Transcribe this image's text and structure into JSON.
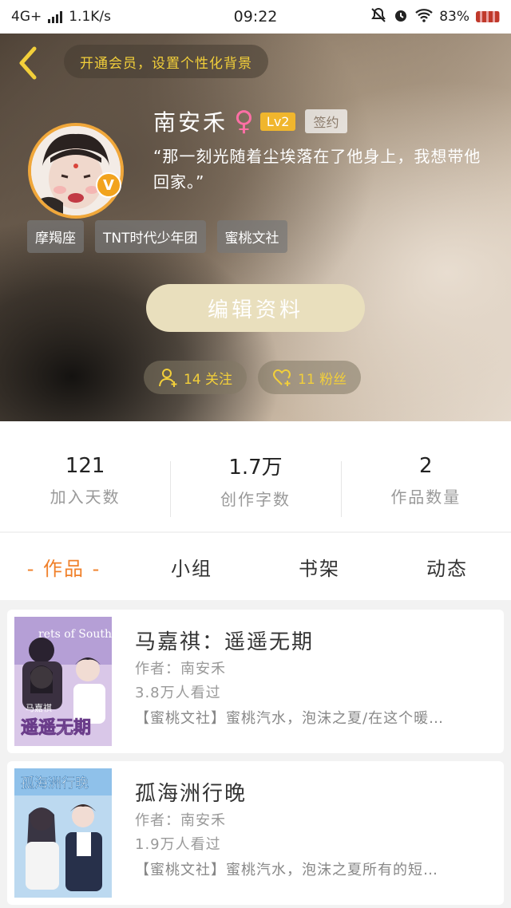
{
  "status_bar": {
    "network": "4G+",
    "speed": "1.1K/s",
    "time": "09:22",
    "battery": "83%",
    "icons": [
      "signal-icon",
      "mute-icon",
      "alarm-icon",
      "wifi-icon",
      "battery-icon"
    ]
  },
  "header": {
    "vip_prompt": "开通会员，设置个性化背景",
    "username": "南安禾",
    "gender_symbol": "♀",
    "level": "Lv2",
    "signed_badge": "签约",
    "bio": "“那一刻光随着尘埃落在了他身上，我想带他回家。”",
    "verified_mark": "V",
    "tags": [
      "摩羯座",
      "TNT时代少年团",
      "蜜桃文社"
    ],
    "edit_button": "编辑资料",
    "follow_label": "14 关注",
    "fans_label": "11 粉丝"
  },
  "stats": [
    {
      "value": "121",
      "label": "加入天数"
    },
    {
      "value": "1.7万",
      "label": "创作字数"
    },
    {
      "value": "2",
      "label": "作品数量"
    }
  ],
  "tabs": [
    "- 作品 -",
    "小组",
    "书架",
    "动态"
  ],
  "active_tab": 0,
  "works": [
    {
      "title": "马嘉祺：遥遥无期",
      "author": "作者：南安禾",
      "views": "3.8万人看过",
      "description": "【蜜桃文社】蜜桃汽水，泡沫之夏/在这个暖…",
      "cover_text": "遥遥无期",
      "cover_caption": "马嘉祺",
      "cover_top_text": "rets of South"
    },
    {
      "title": "孤海洲行晚",
      "author": "作者：南安禾",
      "views": "1.9万人看过",
      "description": "【蜜桃文社】蜜桃汽水，泡沫之夏所有的短…",
      "cover_text": "孤海洲行晚"
    }
  ],
  "colors": {
    "accent_orange": "#f0802a",
    "vip_yellow": "#f2cf3a",
    "level_badge": "#f0b62d",
    "edit_button_bg": "#e9dfbd"
  }
}
